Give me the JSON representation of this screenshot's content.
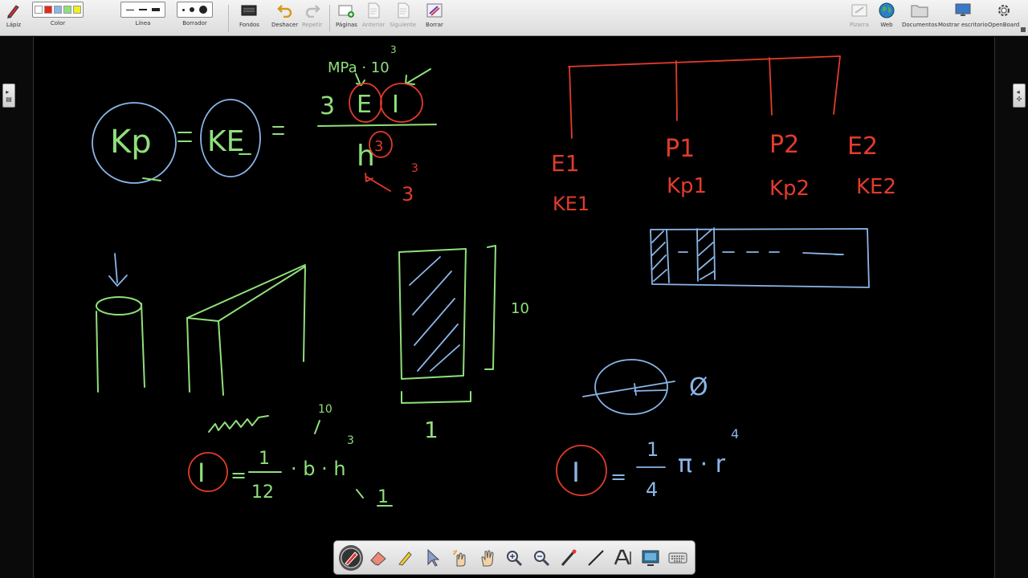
{
  "toolbar": {
    "pencil_label": "Lápiz",
    "color_label": "Color",
    "line_label": "Línea",
    "eraser_label": "Borrador",
    "backgrounds_label": "Fondos",
    "undo_label": "Deshacer",
    "redo_label": "Repetir",
    "pages_label": "Páginas",
    "previous_label": "Anterior",
    "next_label": "Siguiente",
    "erase_label": "Borrar",
    "board_label": "Pizarra",
    "web_label": "Web",
    "documents_label": "Documentos",
    "desktop_label": "Mostrar escritorio",
    "app_label": "OpenBoard",
    "colors": [
      "#ffffff",
      "#e8261b",
      "#8ab6e8",
      "#8fe07a",
      "#f0f020"
    ]
  },
  "board": {
    "formula_top": {
      "kp": "Kp",
      "ke": "KE",
      "three": "3",
      "E": "E",
      "I": "I",
      "units": "MPa · 10",
      "units_exp": "3",
      "h": "h",
      "h_exp": "3",
      "cube_exp": "3",
      "cube": "3"
    },
    "labels_red": {
      "e1": "E1",
      "p1": "P1",
      "p2": "P2",
      "e2": "E2",
      "ke1": "KE1",
      "kp1": "Kp1",
      "kp2": "Kp2",
      "ke2": "KE2"
    },
    "rect_section": {
      "height_label": "10",
      "width_label": "1"
    },
    "formula_rect": {
      "I": "I",
      "eq": "=",
      "num": "1",
      "den": "12",
      "b": "· b · h",
      "exp": "3",
      "sub": "1",
      "ten": "10"
    },
    "formula_circle": {
      "I": "I",
      "eq": "=",
      "num": "1",
      "den": "4",
      "pi": "π · r",
      "exp": "4",
      "phi": "Ø"
    }
  }
}
